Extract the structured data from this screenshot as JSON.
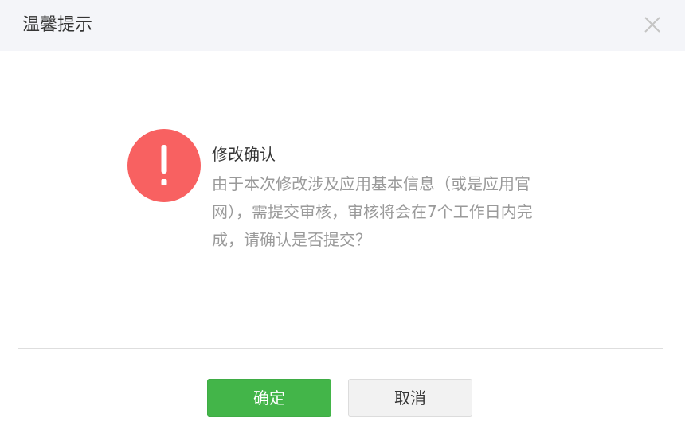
{
  "dialog": {
    "title": "温馨提示",
    "close_icon": "close-icon"
  },
  "message": {
    "icon": "warning-exclamation-icon",
    "icon_color": "#f86161",
    "title": "修改确认",
    "body": "由于本次修改涉及应用基本信息（或是应用官网），需提交审核，审核将会在7个工作日内完成，请确认是否提交？"
  },
  "footer": {
    "confirm_label": "确定",
    "cancel_label": "取消",
    "confirm_color": "#43b549"
  }
}
